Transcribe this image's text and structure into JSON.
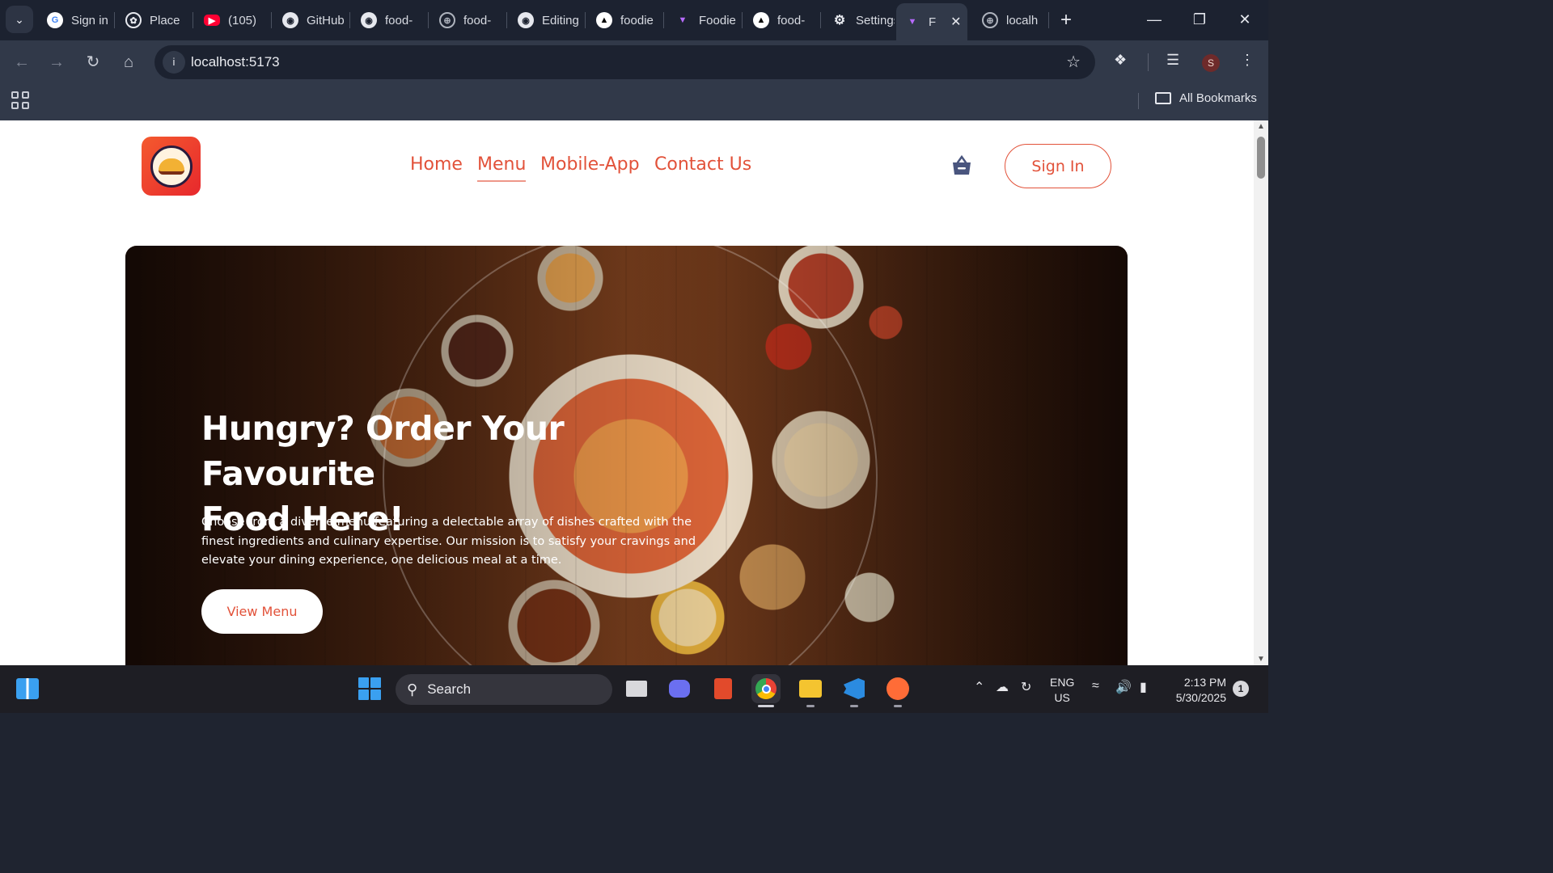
{
  "browser": {
    "tabs": [
      {
        "title": "Sign in",
        "icon": "google-icon"
      },
      {
        "title": "Place",
        "icon": "openai-icon"
      },
      {
        "title": "(105)",
        "icon": "youtube-icon"
      },
      {
        "title": "GitHub",
        "icon": "github-icon"
      },
      {
        "title": "food-",
        "icon": "github-icon"
      },
      {
        "title": "food-",
        "icon": "globe-icon"
      },
      {
        "title": "Editing",
        "icon": "github-icon"
      },
      {
        "title": "foodie",
        "icon": "vercel-icon"
      },
      {
        "title": "Foodie",
        "icon": "vite-icon"
      },
      {
        "title": "food-",
        "icon": "vercel-icon"
      },
      {
        "title": "Settings",
        "icon": "gear-icon"
      },
      {
        "title": "F",
        "icon": "vite-icon",
        "active": true
      },
      {
        "title": "localh",
        "icon": "globe-icon"
      }
    ],
    "url": "localhost:5173",
    "profile_initial": "S",
    "all_bookmarks_label": "All Bookmarks"
  },
  "site": {
    "logo_alt": "FOODIE FUSE",
    "nav": {
      "home": "Home",
      "menu": "Menu",
      "mobile_app": "Mobile-App",
      "contact": "Contact Us"
    },
    "active_nav": "Menu",
    "signin_label": "Sign In",
    "hero": {
      "title_line1": "Hungry? Order Your Favourite",
      "title_line2": "Food Here!",
      "description": "Choose from a diverse menu featuring a delectable array of dishes crafted with the finest ingredients and culinary expertise. Our mission is to satisfy your cravings and elevate your dining experience, one delicious meal at a time.",
      "button_label": "View Menu"
    }
  },
  "taskbar": {
    "search_label": "Search",
    "lang_line1": "ENG",
    "lang_line2": "US",
    "time": "2:13 PM",
    "date": "5/30/2025",
    "notification_count": "1"
  },
  "colors": {
    "accent": "#e2523a",
    "browser_frame": "#313949",
    "tabstrip": "#1c2230"
  }
}
